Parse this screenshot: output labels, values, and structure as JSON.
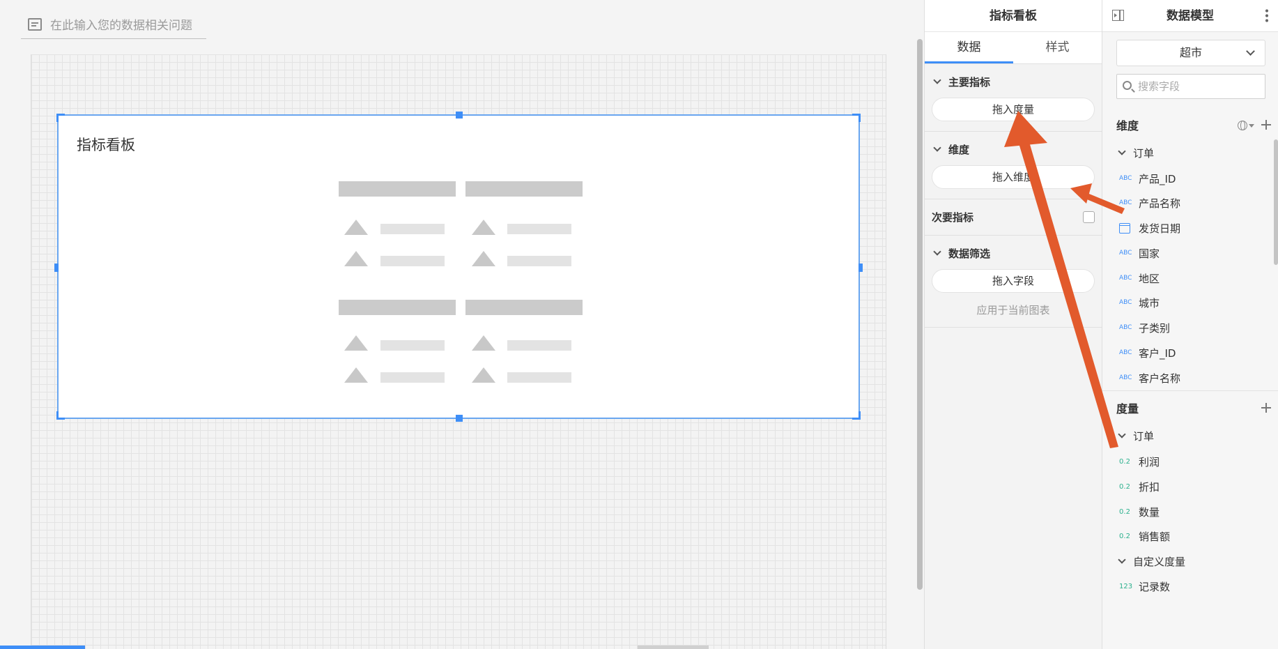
{
  "ask": {
    "placeholder": "在此输入您的数据相关问题"
  },
  "widget": {
    "title": "指标看板"
  },
  "config": {
    "title": "指标看板",
    "tabs": [
      "数据",
      "样式"
    ],
    "main_metric": {
      "label": "主要指标",
      "button": "拖入度量"
    },
    "dimension": {
      "label": "维度",
      "button": "拖入维度"
    },
    "secondary": {
      "label": "次要指标"
    },
    "filter": {
      "label": "数据筛选",
      "button": "拖入字段",
      "apply": "应用于当前图表"
    }
  },
  "model": {
    "title": "数据模型",
    "dataset": "超市",
    "search_placeholder": "搜索字段",
    "dimensions": {
      "label": "维度",
      "folder": "订单",
      "fields": [
        {
          "type": "ABC",
          "name": "产品_ID"
        },
        {
          "type": "ABC",
          "name": "产品名称"
        },
        {
          "type": "calendar",
          "name": "发货日期"
        },
        {
          "type": "ABC",
          "name": "国家"
        },
        {
          "type": "ABC",
          "name": "地区"
        },
        {
          "type": "ABC",
          "name": "城市"
        },
        {
          "type": "ABC",
          "name": "子类别"
        },
        {
          "type": "ABC",
          "name": "客户_ID"
        },
        {
          "type": "ABC",
          "name": "客户名称"
        }
      ]
    },
    "measures": {
      "label": "度量",
      "folder": "订单",
      "fields": [
        {
          "type": "0.2",
          "name": "利润"
        },
        {
          "type": "0.2",
          "name": "折扣"
        },
        {
          "type": "0.2",
          "name": "数量"
        },
        {
          "type": "0.2",
          "name": "销售额"
        }
      ],
      "custom_folder": "自定义度量",
      "custom_fields": [
        {
          "type": "123",
          "name": "记录数"
        }
      ]
    }
  },
  "colors": {
    "accent": "#3e8ef7",
    "annotation": "#e25a2c",
    "number_type": "#2bb08d"
  }
}
